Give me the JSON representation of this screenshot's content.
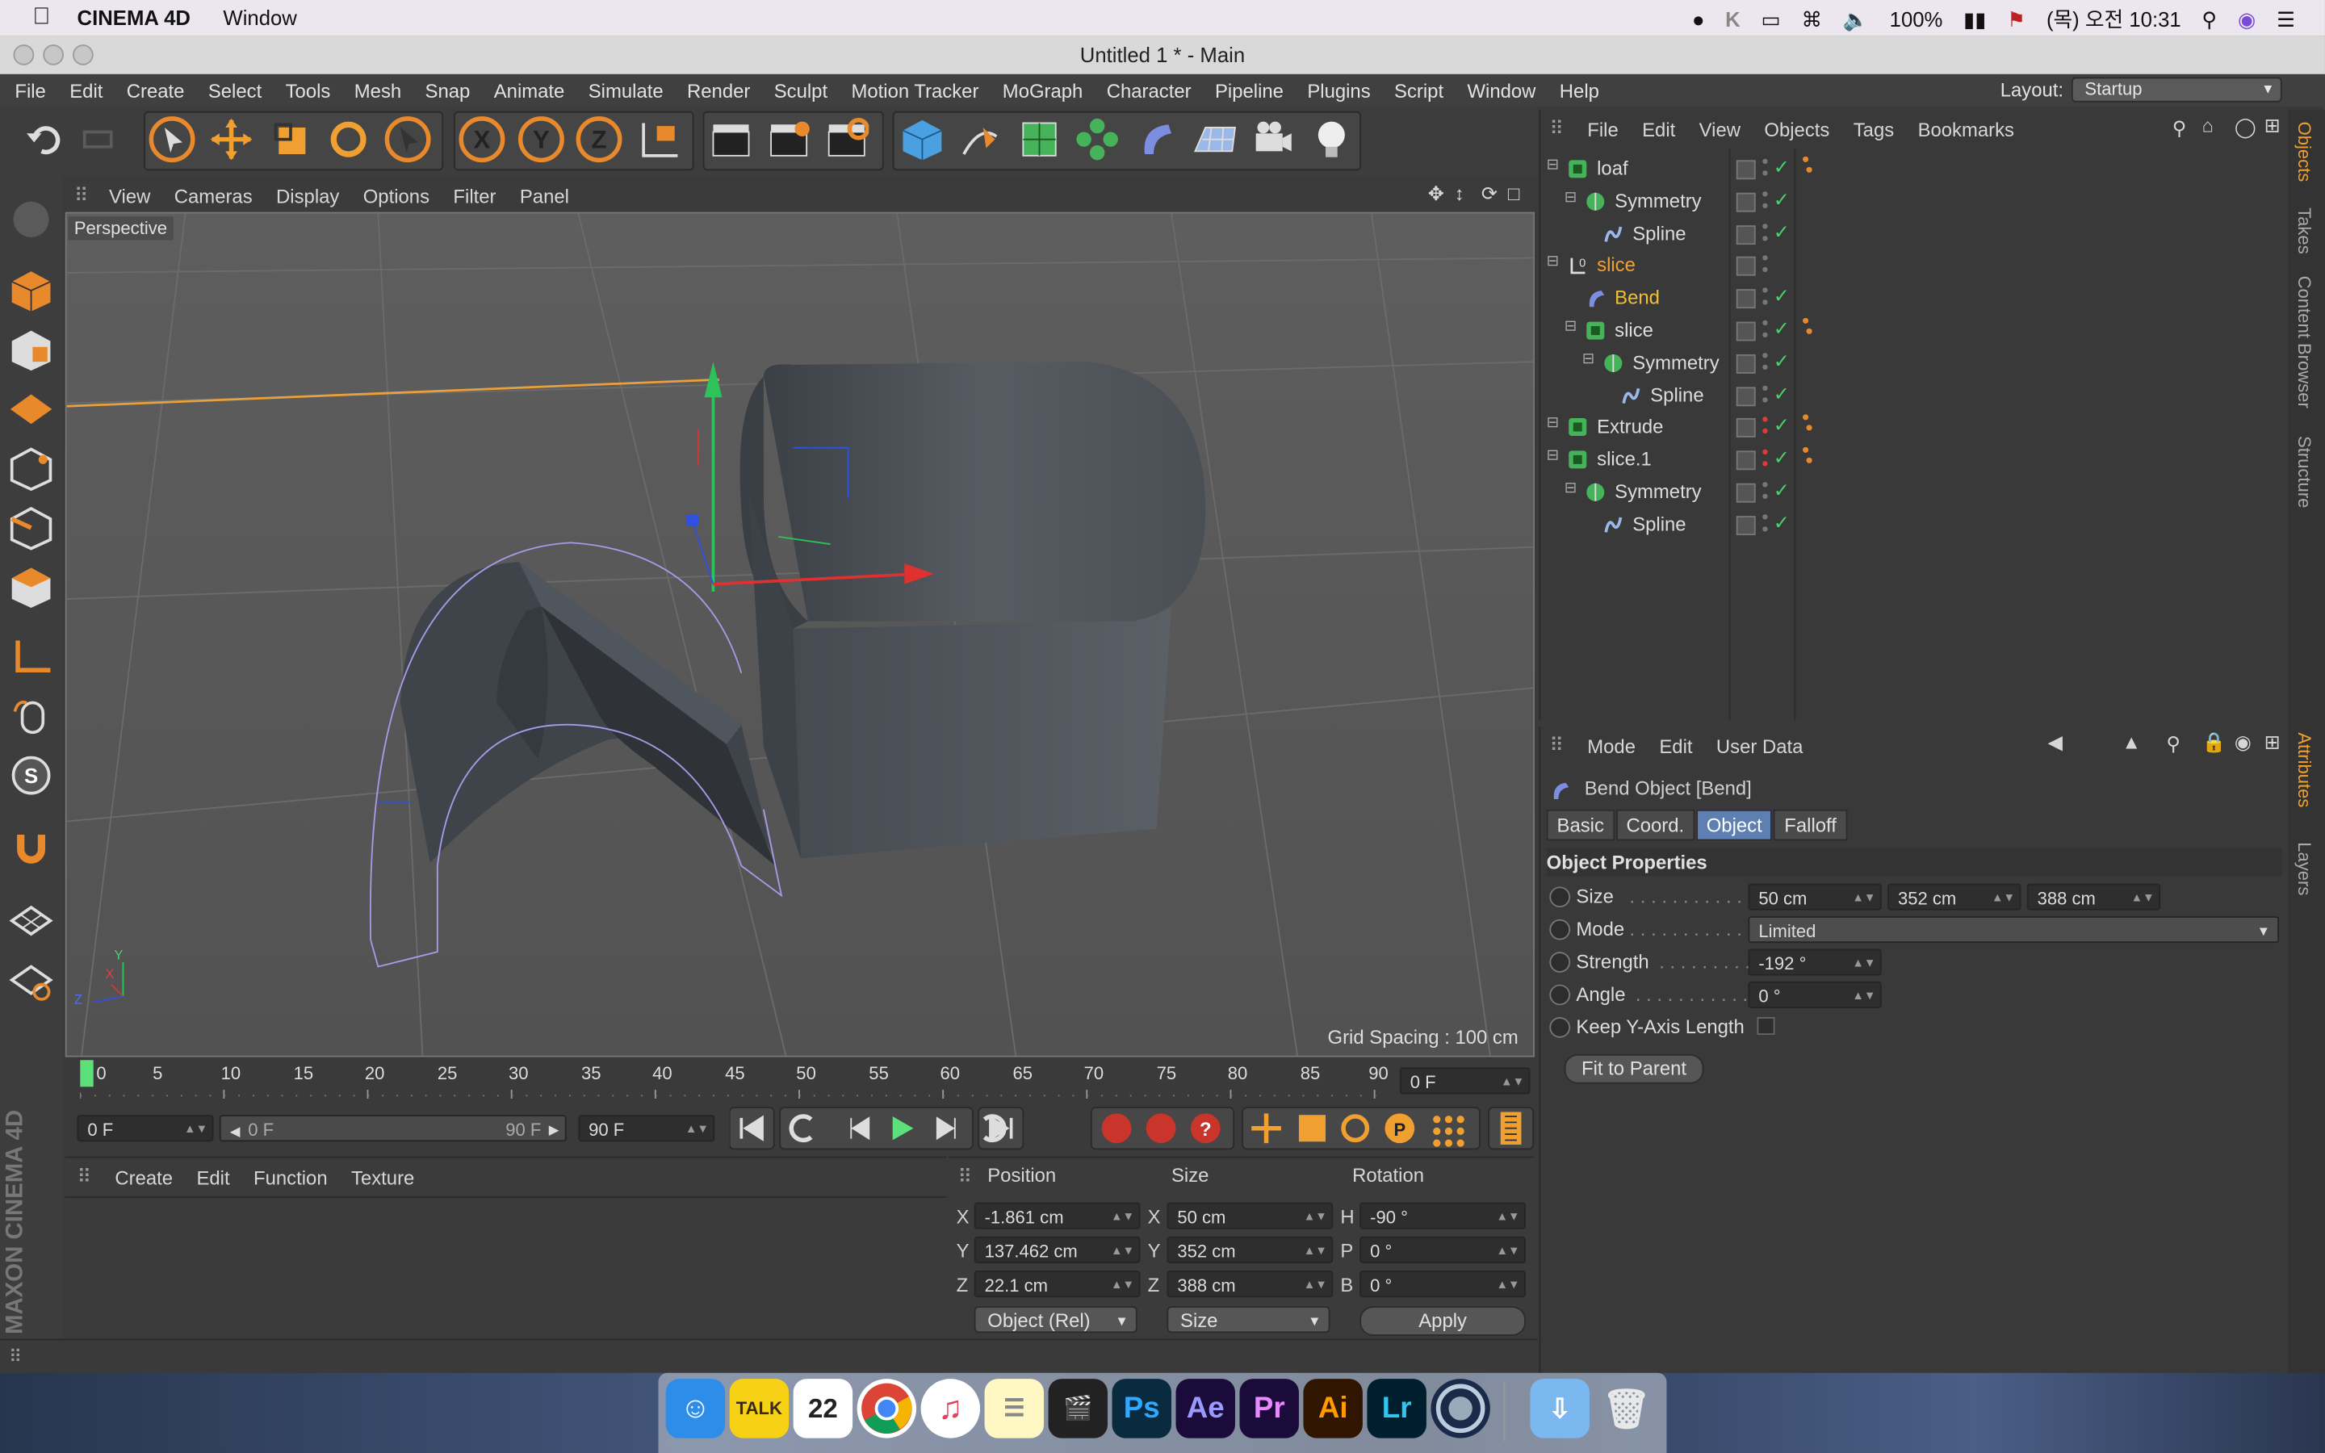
{
  "macbar": {
    "app_name": "CINEMA 4D",
    "menu_window": "Window",
    "battery": "100%",
    "datetime": "(목) 오전 10:31"
  },
  "window": {
    "title": "Untitled 1 * - Main"
  },
  "menubar": {
    "items": [
      "File",
      "Edit",
      "Create",
      "Select",
      "Tools",
      "Mesh",
      "Snap",
      "Animate",
      "Simulate",
      "Render",
      "Sculpt",
      "Motion Tracker",
      "MoGraph",
      "Character",
      "Pipeline",
      "Plugins",
      "Script",
      "Window",
      "Help"
    ],
    "layout_label": "Layout:",
    "layout_value": "Startup"
  },
  "viewport": {
    "menu": [
      "View",
      "Cameras",
      "Display",
      "Options",
      "Filter",
      "Panel"
    ],
    "label": "Perspective",
    "grid_spacing": "Grid Spacing : 100 cm",
    "axis_x": "X",
    "axis_y": "Y",
    "axis_z": "Z"
  },
  "timeline": {
    "ticks": [
      "0",
      "5",
      "10",
      "15",
      "20",
      "25",
      "30",
      "35",
      "40",
      "45",
      "50",
      "55",
      "60",
      "65",
      "70",
      "75",
      "80",
      "85",
      "90"
    ],
    "current_frame": "0 F"
  },
  "transport": {
    "start": "0 F",
    "range_start": "0 F",
    "range_end": "90 F",
    "end": "90 F"
  },
  "materials": {
    "menu": [
      "Create",
      "Edit",
      "Function",
      "Texture"
    ]
  },
  "coords": {
    "headers": {
      "position": "Position",
      "size": "Size",
      "rotation": "Rotation"
    },
    "rows": [
      {
        "axis": "X",
        "pos": "-1.861 cm",
        "size_axis": "X",
        "size": "50 cm",
        "rot_axis": "H",
        "rot": "-90 °"
      },
      {
        "axis": "Y",
        "pos": "137.462 cm",
        "size_axis": "Y",
        "size": "352 cm",
        "rot_axis": "P",
        "rot": "0 °"
      },
      {
        "axis": "Z",
        "pos": "22.1 cm",
        "size_axis": "Z",
        "size": "388 cm",
        "rot_axis": "B",
        "rot": "0 °"
      }
    ],
    "mode": "Object (Rel)",
    "size_mode": "Size",
    "apply": "Apply"
  },
  "objects": {
    "menu": [
      "File",
      "Edit",
      "View",
      "Objects",
      "Tags",
      "Bookmarks"
    ],
    "tree": [
      {
        "name": "loaf",
        "indent": 0,
        "type": "group",
        "color": "#dcdcdc"
      },
      {
        "name": "Symmetry",
        "indent": 1,
        "type": "symmetry",
        "color": "#dcdcdc"
      },
      {
        "name": "Spline",
        "indent": 2,
        "type": "spline",
        "color": "#dcdcdc"
      },
      {
        "name": "slice",
        "indent": 0,
        "type": "null",
        "color": "#f0a030"
      },
      {
        "name": "Bend",
        "indent": 1,
        "type": "bend",
        "color": "#f0c030"
      },
      {
        "name": "slice",
        "indent": 1,
        "type": "group",
        "color": "#dcdcdc"
      },
      {
        "name": "Symmetry",
        "indent": 2,
        "type": "symmetry",
        "color": "#dcdcdc"
      },
      {
        "name": "Spline",
        "indent": 3,
        "type": "spline",
        "color": "#dcdcdc"
      },
      {
        "name": "Extrude",
        "indent": 0,
        "type": "group",
        "color": "#dcdcdc"
      },
      {
        "name": "slice.1",
        "indent": 0,
        "type": "group",
        "color": "#dcdcdc"
      },
      {
        "name": "Symmetry",
        "indent": 1,
        "type": "symmetry",
        "color": "#dcdcdc"
      },
      {
        "name": "Spline",
        "indent": 2,
        "type": "spline",
        "color": "#dcdcdc"
      }
    ]
  },
  "attributes": {
    "menu": [
      "Mode",
      "Edit",
      "User Data"
    ],
    "object_title": "Bend Object [Bend]",
    "tabs": [
      "Basic",
      "Coord.",
      "Object",
      "Falloff"
    ],
    "active_tab": "Object",
    "section": "Object Properties",
    "size_label": "Size",
    "size_x": "50 cm",
    "size_y": "352 cm",
    "size_z": "388 cm",
    "mode_label": "Mode",
    "mode_value": "Limited",
    "strength_label": "Strength",
    "strength_value": "-192 °",
    "angle_label": "Angle",
    "angle_value": "0 °",
    "keep_y_label": "Keep Y-Axis Length",
    "fit_button": "Fit to Parent"
  },
  "right_tabs": [
    "Objects",
    "Takes",
    "Content Browser",
    "Structure",
    "Attributes",
    "Layers"
  ],
  "branding": "MAXON CINEMA 4D",
  "dock": {
    "talk": "TALK",
    "calendar": "22",
    "ps": "Ps",
    "ae": "Ae",
    "pr": "Pr",
    "ai": "Ai",
    "lr": "Lr"
  },
  "colors": {
    "accent_orange": "#e8892b",
    "accent_blue": "#5d7fb2",
    "viewport_bg": "#585858"
  }
}
